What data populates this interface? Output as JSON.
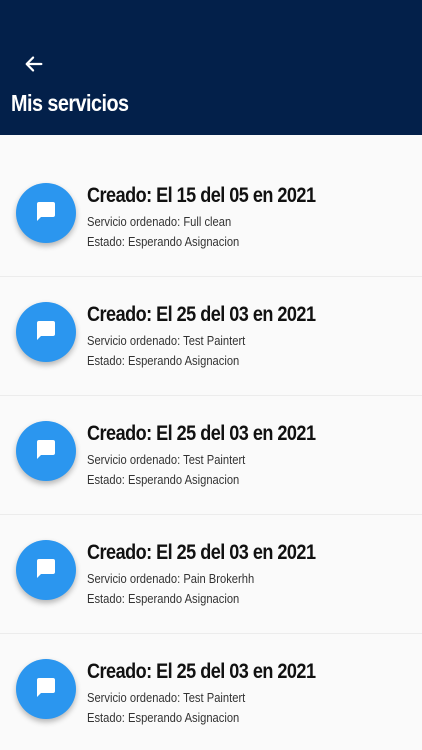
{
  "header": {
    "title": "Mis servicios",
    "back_icon": "arrow-left-icon",
    "background": "#03204a"
  },
  "list": {
    "item_icon": "chat-bubble-icon",
    "accent": "#2b96ef",
    "items": [
      {
        "title": "Creado: El 15 del 05 en 2021",
        "service": "Servicio ordenado: Full clean",
        "status": "Estado: Esperando Asignacion"
      },
      {
        "title": "Creado: El 25 del 03 en 2021",
        "service": "Servicio ordenado: Test Paintert",
        "status": "Estado: Esperando Asignacion"
      },
      {
        "title": "Creado: El 25 del 03 en 2021",
        "service": "Servicio ordenado: Test Paintert",
        "status": "Estado: Esperando Asignacion"
      },
      {
        "title": "Creado: El 25 del 03 en 2021",
        "service": "Servicio ordenado: Pain Brokerhh",
        "status": "Estado: Esperando Asignacion"
      },
      {
        "title": "Creado: El 25 del 03 en 2021",
        "service": "Servicio ordenado: Test Paintert",
        "status": "Estado: Esperando Asignacion"
      }
    ]
  }
}
